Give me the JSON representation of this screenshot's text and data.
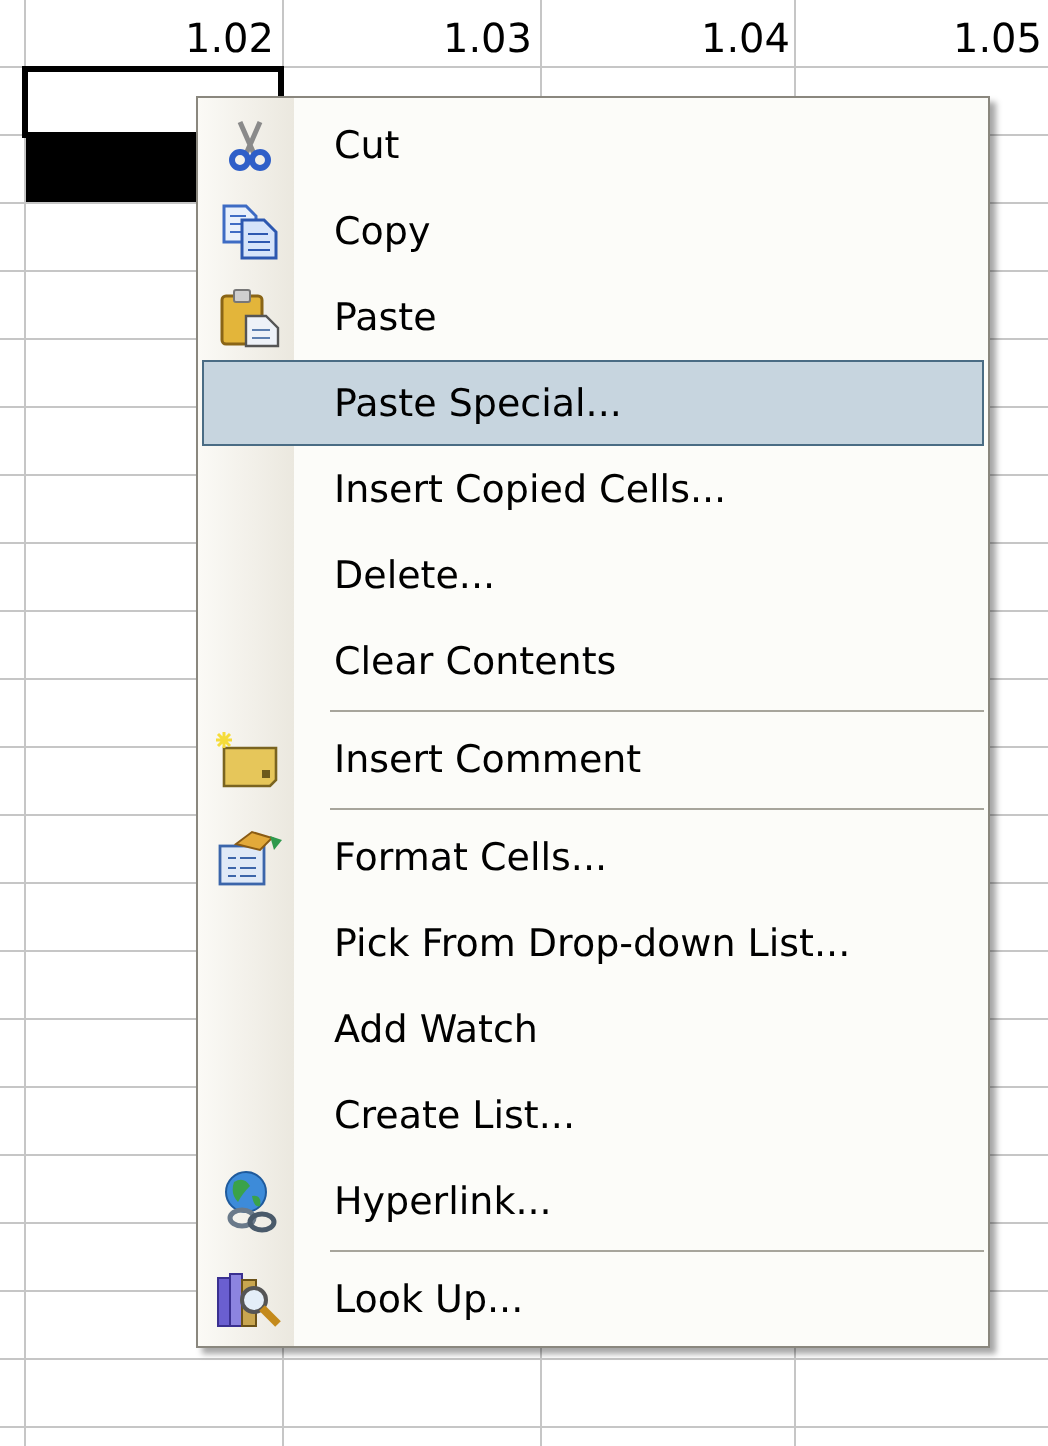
{
  "sheet": {
    "rows": [
      {
        "cells": [
          {
            "value": "1.02"
          },
          {
            "value": "1.03"
          },
          {
            "value": "1.04"
          },
          {
            "value": "1.05"
          }
        ]
      },
      {
        "cells": [
          {
            "selected": true
          },
          {
            "selected": false
          },
          {
            "selected": false
          },
          {
            "selected": false
          }
        ]
      },
      {
        "cells": [
          {
            "filled": true
          }
        ]
      }
    ]
  },
  "context_menu": {
    "items": [
      {
        "kind": "item",
        "label": "Cut",
        "selected": false
      },
      {
        "kind": "item",
        "label": "Copy",
        "selected": false
      },
      {
        "kind": "item",
        "label": "Paste",
        "selected": false
      },
      {
        "kind": "item",
        "label": "Paste Special...",
        "selected": true
      },
      {
        "kind": "item",
        "label": "Insert Copied Cells...",
        "selected": false
      },
      {
        "kind": "item",
        "label": "Delete...",
        "selected": false
      },
      {
        "kind": "item",
        "label": "Clear Contents",
        "selected": false
      },
      {
        "kind": "separator"
      },
      {
        "kind": "item",
        "label": "Insert Comment",
        "selected": false
      },
      {
        "kind": "separator"
      },
      {
        "kind": "item",
        "label": "Format Cells...",
        "selected": false
      },
      {
        "kind": "item",
        "label": "Pick From Drop-down List...",
        "selected": false
      },
      {
        "kind": "item",
        "label": "Add Watch",
        "selected": false
      },
      {
        "kind": "item",
        "label": "Create List...",
        "selected": false
      },
      {
        "kind": "item",
        "label": "Hyperlink...",
        "selected": false
      },
      {
        "kind": "separator"
      },
      {
        "kind": "item",
        "label": "Look Up...",
        "selected": false
      }
    ]
  }
}
